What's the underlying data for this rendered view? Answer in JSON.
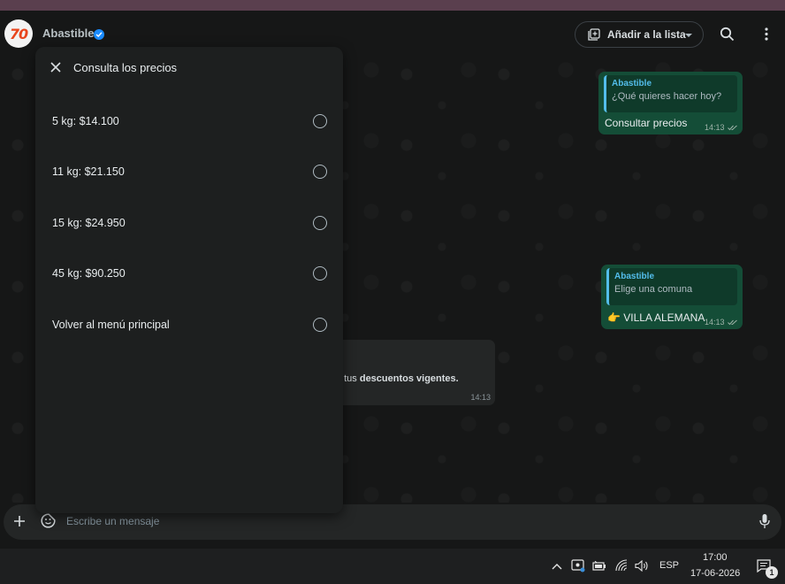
{
  "header": {
    "avatar_text": "70",
    "contact_name": "Abastible",
    "add_to_list_label": "Añadir a la lista"
  },
  "panel": {
    "title": "Consulta los precios",
    "options": [
      {
        "label": "5 kg: $14.100"
      },
      {
        "label": "11 kg: $21.150"
      },
      {
        "label": "15 kg: $24.950"
      },
      {
        "label": "45 kg: $90.250"
      },
      {
        "label": "Volver al menú principal"
      }
    ]
  },
  "messages": {
    "outgoing": [
      {
        "quote_name": "Abastible",
        "quote_text": "¿Qué quieres hacer hoy?",
        "text": "Consultar precios",
        "time": "14:13"
      },
      {
        "quote_name": "Abastible",
        "quote_text": "Elige una comuna",
        "text": "👉 VILLA ALEMANA",
        "time": "14:13"
      }
    ],
    "incoming_partial": {
      "text_plain": "s y tus ",
      "text_bold": "descuentos vigentes.",
      "time": "14:13"
    }
  },
  "composer": {
    "placeholder": "Escribe un mensaje"
  },
  "taskbar": {
    "language": "ESP",
    "time": "17:00",
    "date": "17-06-2026",
    "notification_count": "1"
  },
  "colors": {
    "accent": "#53bdeb",
    "outgoing_bubble": "#144d37",
    "verified_badge": "#1b8cff"
  }
}
